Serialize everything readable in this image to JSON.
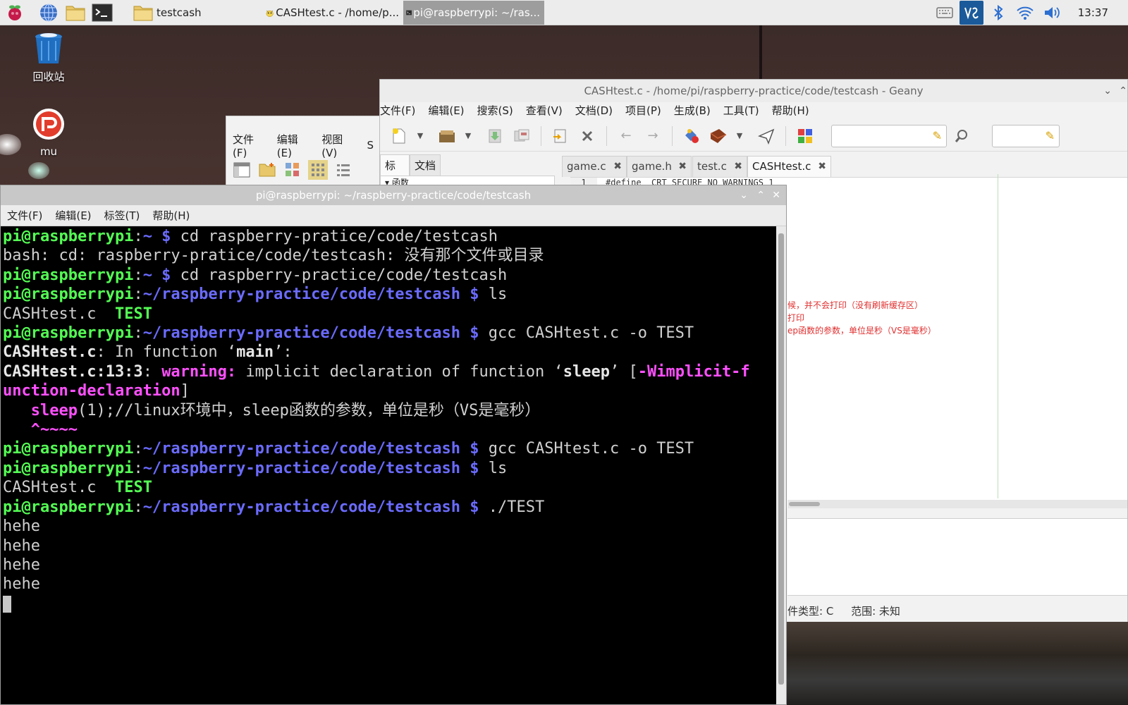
{
  "taskbar": {
    "testcash_label": "testcash",
    "geany_label": "CASHtest.c - /home/p...",
    "terminal_label": "pi@raspberrypi: ~/ras...",
    "clock": "13:37"
  },
  "desktop": {
    "trash_label": "回收站",
    "mu_label": "mu"
  },
  "geany": {
    "title": "CASHtest.c - /home/pi/raspberry-practice/code/testcash - Geany",
    "menu": [
      "文件(F)",
      "编辑(E)",
      "搜索(S)",
      "查看(V)",
      "文档(D)",
      "项目(P)",
      "生成(B)",
      "工具(T)",
      "帮助(H)"
    ],
    "side_tabs": [
      "标记",
      "文档"
    ],
    "side_item": "函数",
    "doc_tabs": [
      "game.c",
      "game.h",
      "test.c",
      "CASHtest.c"
    ],
    "code_line_no": "1",
    "code_line": "#define _CRT_SECURE_NO_WARNINGS 1",
    "comments": [
      "候，并不会打印（没有刷新缓存区）",
      "打印",
      "ep函数的参数，单位是秒（VS是毫秒）"
    ],
    "status_filetype": "件类型: C",
    "status_scope": "范围: 未知"
  },
  "file_manager": {
    "menu": [
      "文件(F)",
      "编辑(E)",
      "视图(V)",
      "S"
    ]
  },
  "terminal": {
    "title": "pi@raspberrypi: ~/raspberry-practice/code/testcash",
    "menu": [
      "文件(F)",
      "编辑(E)",
      "标签(T)",
      "帮助(H)"
    ],
    "user": "pi@raspberrypi",
    "cmd1": " cd raspberry-pratice/code/testcash",
    "err1": "bash: cd: raspberry-pratice/code/testcash: 没有那个文件或目录",
    "cmd2": " cd raspberry-practice/code/testcash",
    "path": "~/raspberry-practice/code/testcash",
    "cmd_ls": " ls",
    "file1": "CASHtest.c",
    "file2": "TEST",
    "cmd_gcc": " gcc CASHtest.c -o TEST",
    "warn_file": "CASHtest.c",
    "warn_infn": ": In function ‘",
    "warn_main": "main",
    "warn_infn_end": "’:",
    "warn_loc": "CASHtest.c:13:3",
    "warn_word": "warning:",
    "warn_msg_a": " implicit declaration of function ‘",
    "warn_sleep": "sleep",
    "warn_msg_b": "’ [",
    "warn_flag_a": "-Wimplicit-f",
    "warn_flag_b": "unction-declaration",
    "warn_close": "]",
    "src_indent": "   ",
    "src_sleep": "sleep",
    "src_rest": "(1);//linux环境中，sleep函数的参数，单位是秒（VS是毫秒）",
    "caret": "   ^~~~~",
    "cmd_run": " ./TEST",
    "output": [
      "hehe",
      "hehe",
      "hehe",
      "hehe"
    ]
  }
}
